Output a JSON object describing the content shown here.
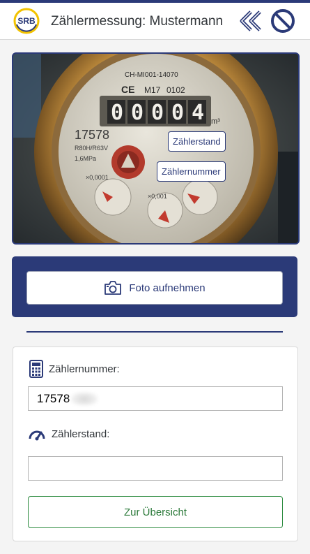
{
  "header": {
    "logo_text": "SRB",
    "title": "Zählermessung: Mustermann",
    "back_icon": "double-chevron-left-icon",
    "cancel_icon": "prohibit-icon"
  },
  "photo": {
    "meter_digits": [
      "0",
      "0",
      "0",
      "0",
      "4"
    ],
    "meter_top_text": "CH-MI001-14070",
    "meter_serial": "17578",
    "meter_model": "R80H/R63V",
    "meter_pressure": "1,6MPa",
    "meter_unit": "m³",
    "meter_mark": "M17",
    "meter_code": "0102",
    "dial_left": "×0,0001",
    "dial_right": "×0,001",
    "tag_stand": "Zählerstand",
    "tag_nummer": "Zählernummer"
  },
  "camera": {
    "button_label": "Foto aufnehmen",
    "icon": "camera-icon"
  },
  "form": {
    "number_label": "Zählernummer:",
    "number_value": "17578",
    "number_icon": "calculator-icon",
    "stand_label": "Zählerstand:",
    "stand_value": "",
    "stand_icon": "gauge-icon",
    "overview_button": "Zur Übersicht"
  },
  "colors": {
    "brand": "#2b3a78",
    "success": "#2b8a3e",
    "logo_ring": "#f2c200"
  }
}
